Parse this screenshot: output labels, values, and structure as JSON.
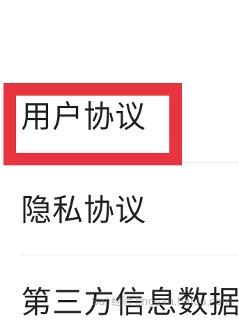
{
  "menu": {
    "items": [
      {
        "label": "用户协议"
      },
      {
        "label": "隐私协议"
      },
      {
        "label": "第三方信息数据"
      }
    ]
  },
  "annotation": {
    "highlight_color": "#e8343f",
    "highlighted_item": "用户协议"
  },
  "watermark": {
    "text": "Bai 经验 jingyan.baidu.com"
  }
}
